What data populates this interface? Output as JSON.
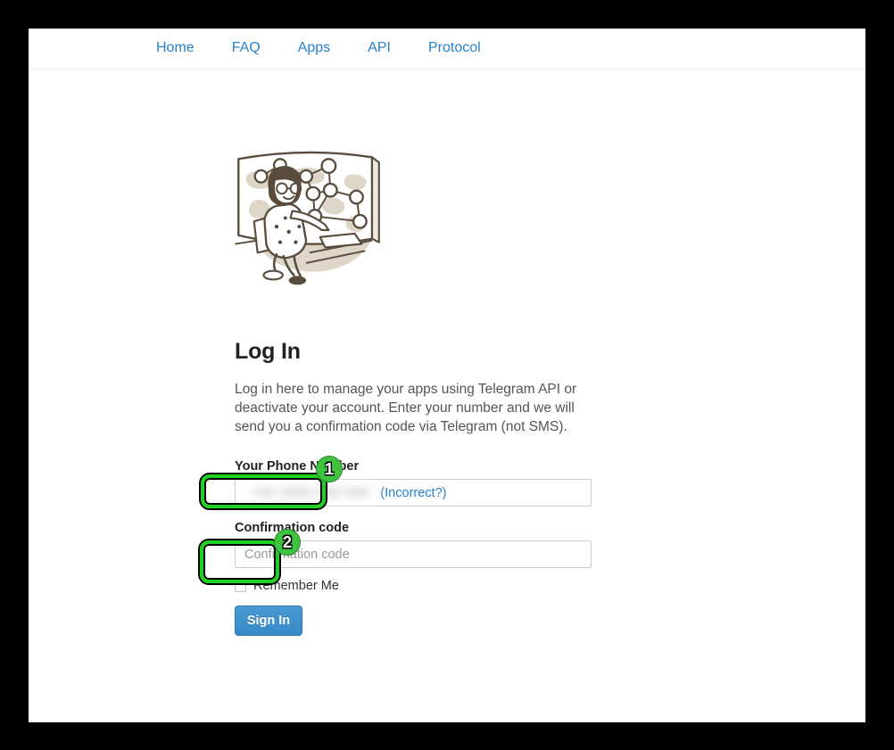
{
  "nav": {
    "items": [
      {
        "label": "Home",
        "name": "nav-link-home"
      },
      {
        "label": "FAQ",
        "name": "nav-link-faq"
      },
      {
        "label": "Apps",
        "name": "nav-link-apps"
      },
      {
        "label": "API",
        "name": "nav-link-api"
      },
      {
        "label": "Protocol",
        "name": "nav-link-protocol"
      }
    ]
  },
  "illustration": {
    "alt": "woman-at-network-map-illustration",
    "line_color": "#5a4c3c",
    "fill_color": "#ddd5c5",
    "skin_color": "#ffffff"
  },
  "main": {
    "title": "Log In",
    "description": "Log in here to manage your apps using Telegram API or deactivate your account. Enter your number and we will send you a confirmation code via Telegram (not SMS)."
  },
  "form": {
    "phone": {
      "label": "Your Phone Number",
      "value": "+00 0000 000 000",
      "incorrect_link": "(Incorrect?)",
      "redacted": true
    },
    "code": {
      "label": "Confirmation code",
      "value": "",
      "placeholder": "Confirmation code"
    },
    "remember": {
      "label": "Remember Me",
      "checked": false
    },
    "submit": {
      "label": "Sign In"
    }
  },
  "annotations": [
    {
      "badge": "1",
      "target": "confirmation-code-input"
    },
    {
      "badge": "2",
      "target": "sign-in-button"
    }
  ],
  "colors": {
    "link_blue": "#2481cc",
    "button_blue": "#3c92ce",
    "annotation_green": "#1fd11f",
    "badge_green": "#3fc23f",
    "page_background": "#ffffff",
    "frame_black": "#000000",
    "border_gray": "#cccccc"
  }
}
